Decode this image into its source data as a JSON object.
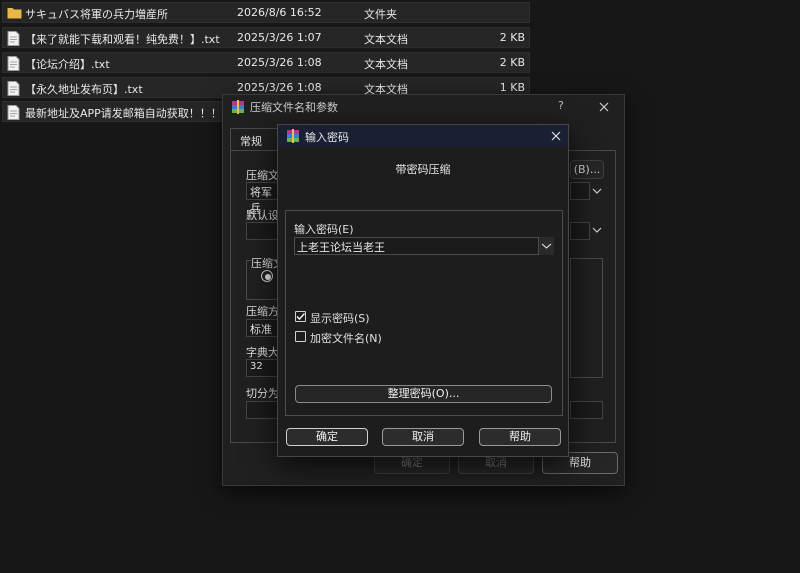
{
  "files": [
    {
      "name": "サキュバス将軍の兵力増産所",
      "date": "2026/8/6 16:52",
      "type": "文件夹",
      "size": "",
      "icon": "folder-icon"
    },
    {
      "name": "【来了就能下载和观看！纯免费！】.txt",
      "date": "2025/3/26 1:07",
      "type": "文本文档",
      "size": "2 KB",
      "icon": "text-file-icon"
    },
    {
      "name": "【论坛介绍】.txt",
      "date": "2025/3/26 1:08",
      "type": "文本文档",
      "size": "2 KB",
      "icon": "text-file-icon"
    },
    {
      "name": "【永久地址发布页】.txt",
      "date": "2025/3/26 1:08",
      "type": "文本文档",
      "size": "1 KB",
      "icon": "text-file-icon"
    },
    {
      "name": "最新地址及APP请发邮箱自动获取！！！....",
      "date": "",
      "type": "",
      "size": "",
      "icon": "text-file-icon"
    }
  ],
  "archive_dialog": {
    "title": "压缩文件名和参数",
    "help_glyph": "?",
    "tab_general": "常规",
    "label_archive_name": "压缩文",
    "archive_name_value": "将军兵",
    "browse_label": "(B)...",
    "label_default": "默认设",
    "label_format": "压缩文",
    "label_method": "压缩方",
    "method_value": "标准",
    "label_dict": "字典大",
    "dict_value": "32",
    "label_split": "切分为",
    "ok": "确定",
    "cancel": "取消",
    "help": "帮助"
  },
  "password_dialog": {
    "title": "输入密码",
    "heading": "带密码压缩",
    "label_enter": "输入密码(E)",
    "password_value": "上老王论坛当老王",
    "show_password": "显示密码(S)",
    "show_password_checked": true,
    "encrypt_names": "加密文件名(N)",
    "encrypt_names_checked": false,
    "organize": "整理密码(O)...",
    "ok": "确定",
    "cancel": "取消",
    "help": "帮助"
  },
  "colors": {
    "background": "#171717",
    "dialog": "#1d1d1d",
    "titlebar": "#1a2033",
    "folder": "#e8b74a"
  }
}
